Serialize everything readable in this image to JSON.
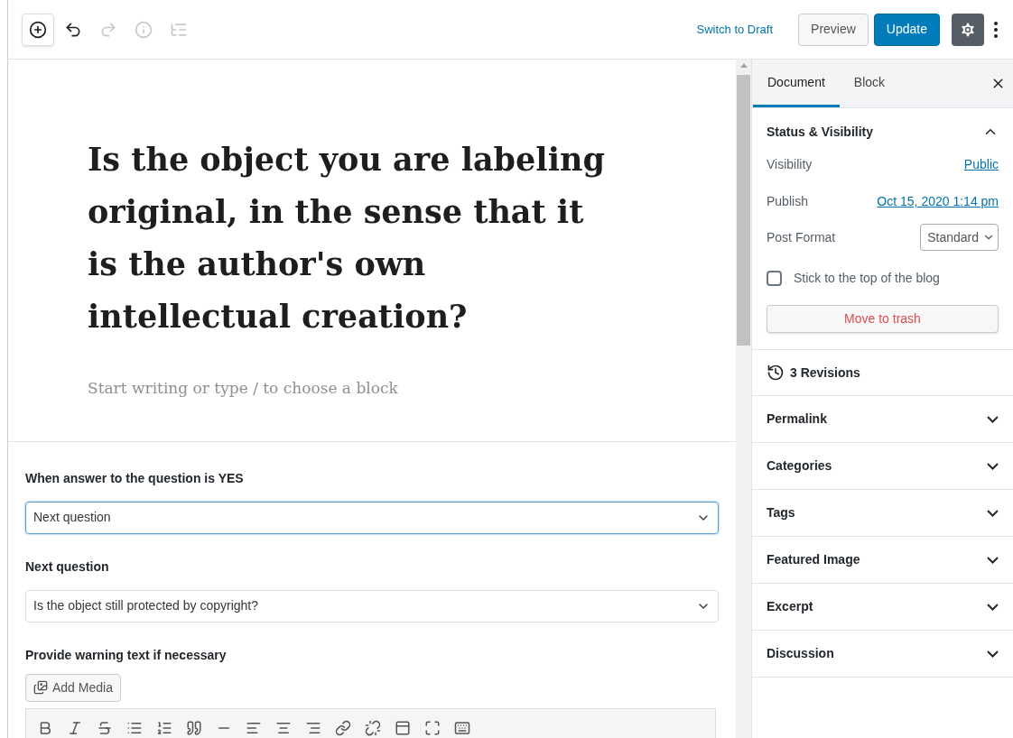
{
  "toolbar": {
    "tools": [
      {
        "kind": "inserter",
        "disabled": false
      },
      {
        "kind": "undo",
        "disabled": false
      },
      {
        "kind": "redo",
        "disabled": true
      },
      {
        "kind": "info",
        "disabled": true
      },
      {
        "kind": "outline",
        "disabled": true
      }
    ],
    "switch_to_draft": "Switch to Draft",
    "preview": "Preview",
    "update": "Update",
    "settings_on": true
  },
  "editor": {
    "title": "Is the object you are labeling original, in the sense that it is the author's own intellectual creation?",
    "block_placeholder": "Start writing or type / to choose a block",
    "fields": [
      {
        "label": "When answer to the question is YES",
        "value": "Next question",
        "focused": true
      },
      {
        "label": "Next question",
        "value": "Is the object still protected by copyright?",
        "focused": false
      }
    ],
    "warning_label": "Provide warning text if necessary",
    "add_media": "Add Media"
  },
  "sidebar": {
    "tabs": [
      {
        "label": "Document",
        "selected": true
      },
      {
        "label": "Block",
        "selected": false
      }
    ],
    "status": {
      "title": "Status & Visibility",
      "expanded": true,
      "visibility_label": "Visibility",
      "visibility": "Public",
      "publish_label": "Publish",
      "publish": "Oct 15, 2020 1:14 pm",
      "format_label": "Post Format",
      "format": "Standard",
      "sticky_label": "Stick to the top of the blog",
      "sticky": false,
      "trash": "Move to trash"
    },
    "revisions": "3 Revisions",
    "panels": [
      {
        "title": "Permalink",
        "expanded": false
      },
      {
        "title": "Categories",
        "expanded": false
      },
      {
        "title": "Tags",
        "expanded": false
      },
      {
        "title": "Featured Image",
        "expanded": false
      },
      {
        "title": "Excerpt",
        "expanded": false
      },
      {
        "title": "Discussion",
        "expanded": false
      }
    ]
  }
}
